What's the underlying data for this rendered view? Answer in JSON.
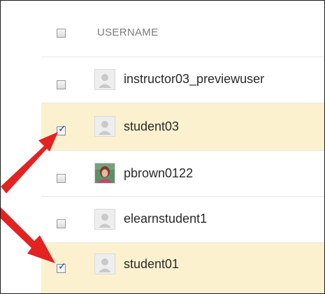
{
  "header": {
    "column_label": "USERNAME",
    "select_all_checked": false
  },
  "rows": [
    {
      "username": "instructor03_previewuser",
      "checked": false,
      "avatar": "default-avatar-icon"
    },
    {
      "username": "student03",
      "checked": true,
      "avatar": "default-avatar-icon"
    },
    {
      "username": "pbrown0122",
      "checked": false,
      "avatar": "profile-photo"
    },
    {
      "username": "elearnstudent1",
      "checked": false,
      "avatar": "default-avatar-icon"
    },
    {
      "username": "student01",
      "checked": true,
      "avatar": "default-avatar-icon"
    }
  ],
  "colors": {
    "selected_row": "#fbf1cf",
    "arrow": "#e32222",
    "checkmark": "#2c3f86"
  }
}
